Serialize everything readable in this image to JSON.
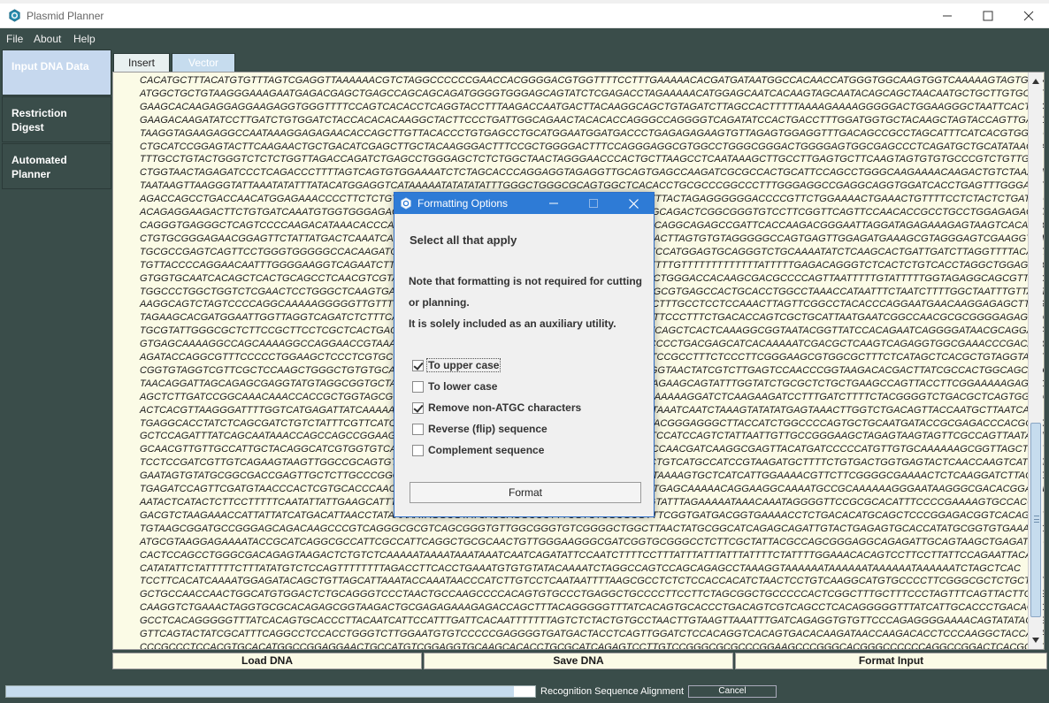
{
  "window": {
    "title": "Plasmid Planner",
    "minimize_icon": "minimize-icon",
    "maximize_icon": "maximize-icon",
    "close_icon": "close-icon"
  },
  "menu": [
    "File",
    "About",
    "Help"
  ],
  "sidebar": {
    "items": [
      {
        "label": "Input DNA Data",
        "active": true
      },
      {
        "label": "Restriction Digest",
        "active": false
      },
      {
        "label": "Automated Planner",
        "active": false
      }
    ]
  },
  "tabs": [
    {
      "label": "Insert",
      "active": false
    },
    {
      "label": "Vector",
      "active": true
    }
  ],
  "sequence_lines": [
    "CACATGCTTTACATGTGTTTAGTCGAGGTTAAAAAACGTCTAGGCCCCCCGAACCACGGGGACGTGGTTTTCCTTTGAAAAACACGATGATAATGGCCACAACCATGGGTGGCAAGTGGTCAAAAAGTAGTGTGATTGG",
    "ATGGCTGCTGTAAGGGAAAGAATGAGACGAGCTGAGCCAGCAGCAGATGGGGTGGGAGCAGTATCTCGAGACCTAGAAAAACATGGAGCAATCACAAGTAGCAATACAGCAGCTAACAATGCTGCTTGTGCCTGGCTA",
    "GAAGCACAAGAGGAGGAAGAGGTGGGTTTTCCAGTCACACCTCAGGTACCTTTAAGACCAATGACTTACAAGGCAGCTGTAGATCTTAGCCACTTTTTAAAAGAAAAGGGGGACTGGAAGGGCTAATTCACTCCCAAA",
    "GAAGACAAGATATCCTTGATCTGTGGATCTACCACACACAAGGCTACTTCCCTGATTGGCAGAACTACACACCAGGGCCAGGGGTCAGATATCCACTGACCTTTGGATGGTGCTACAAGCTAGTACCAGTTGAGCCAGA",
    "TAAGGTAGAAGAGGCCAATAAAGGAGAGAACACCAGCTTGTTACACCCTGTGAGCCTGCATGGAATGGATGACCCTGAGAGAGAAGTGTTAGAGTGGAGGTTTGACAGCCGCCTAGCATTTCATCACGTGGCCCGAGAG",
    "CTGCATCCGGAGTACTTCAAGAACTGCTGACATCGAGCTTGCTACAAGGGACTTTCCGCTGGGGACTTTCCAGGGAGGCGTGGCCTGGGCGGGACTGGGGAGTGGCGAGCCCTCAGATGCTGCATATAAGCAGCTGCTT",
    "TTTGCCTGTACTGGGTCTCTCTGGTTAGACCAGATCTGAGCCTGGGAGCTCTCTGGCTAACTAGGGAACCCACTGCTTAAGCCTCAATAAAGCTTGCCTTGAGTGCTTCAAGTAGTGTGTGCCCGTCTGTTGTGTGACT",
    "CTGGTAACTAGAGATCCCTCAGACCCTTTTAGTCAGTGTGGAAAATCTCTAGCACCCAGGAGGTAGAGGTTGCAGTGAGCCAAGATCGCGCCACTGCATTCCAGCCTGGGCAAGAAAACAAGACTGTCTAAAATAATAA",
    "TAATAAGTTAAGGGTATTAAATATATTTATACATGGAGGTCATAAAAATATATATATTTGGGCTGGGCGCAGTGGCTCACACCTGCGCCCGGCCCTTTGGGAGGCCGAGGCAGGTGGATCACCTGAGTTTGGGAGTTCC",
    "AGACCAGCCTGACCAACATGGAGAAACCCCTTCTCTGTGTATTTTTAGTAGATTTTATTTTATTGTATTTTATTCAGCTTTTACTAGAGGGGGGACCCCGTTCTGGAAAACTGAAACTGTTTTCCTCTACTCTGATACCACAAGAATCATCAGC",
    "ACAGAGGAAGACTTCTGTGATCAAATGTGGTGGGAGAGGGAGGTTTTCACCAGCACATGAGCAGTCAGTTCTGCCGCAGACTCGGCGGGTGTCCTTCGGTTCAGTTCCAACACCGCCTGCCTGGAGAGAGGTCAGCACCA",
    "CAGGGTGAGGGCTCAGTCCCCAAGACATAAACACCCAAGACATAAACACCCAACAGGTCCACCCCGCCTGCTGCCCAGGCAGAGCCGATTCACCAAGACGGGAATTAGGATAGAGAAAGAGTAAGTCACACAGAGCCGG",
    "CTGTGCGGGAGAACGGAGTTCTATTATGACTCAAATCAGTCTCCCCAAGCATTCGGGGATCAGAGTTTTTAAGGATAACTTAGTGTGTAGGGGGCCAGTGAGTTGGAGATGAAAGCGTAGGGAGTCGAAGGTGTCCTTT",
    "TGCGCCGAGTCAGTTCCTGGGTGGGGGCCACAAGATCGGATGAGCCAGTTTATCAATCCGGGGGTGCCAGCTGATCCATGGAGTGCAGGGTCTGCAAAATATCTCAAGCACTGATTGATCTTAGGTTTTACAATAGTGA",
    "TGTTACCCCAGGAACAATTTGGGGAAGGTCAGAATCTTGTAGCCTGTAGCTGCATGACTCCTAAACCATAATTTCTTTTTTGTTTTTTTTTTTTTATTTTTGAGACAGGGTCTCACTCTGTCACCTAGGCTGGAGTGCA",
    "GTGGTGCAATCACAGCTCACTGCAGCCTCAACGTCGTAAGCTCAAGCGATCCTCCCACCTCAGCCTCCCGAGCAGCTGGGACCACAAGCGACGCCCCAGTTAATTTTTGTATTTTTGGTAGAGGCAGCGTTTTGCCGTG",
    "TGGCCCTGGCTGGTCTCGAACTCCTGGGCTCAAGTGATCCACCCACCTCAGCCTCCCAAAGTGCTGGGATTACAGGCGTGAGCCACTGCACCTGGCCTAAACCATAATTTCTAATCTTTTGGCTAATTTGTTAGTCCTACA",
    "AAGGCAGTCTAGTCCCCAGGCAAAAAGGGGGTTGTTTCGGTGTTGATTTTACTTATTTCACCACAAGGTTAGTTTACCTTTGCCTCCTCCAAACTTAGTTCGGCCTACACCCAGGAATGAACAAGGAGAGCTTGGAGGT",
    "TAGAAGCACGATGGAATTGGTTAGGTCAGATCTCTTTCACTGTCTGAGTTCCTCCAGGACTGCAAAGCTCTCATCATTTCCCTTTCTGACACCAGTCGCTGCATTAATGAATCGGCCAACGCGCGGGGAGAGGCGGTT",
    "TGCGTATTGGGCGCTCTTCCGCTTCCTCGCTCACTGACTCGCTGCGCTCGGTCGTTCGGCTGCGGCGAGCGGTATCAGCTCACTCAAAGGCGGTAATACGGTTATCCACAGAATCAGGGGATAACGCAGGAAAGAACAT",
    "GTGAGCAAAAGGCCAGCAAAAGGCCAGGAACCGTAAAAAGGCCGCGTTGCTGGCGTTTTTCCATAGGCTCCGCCCCCCTGACGAGCATCACAAAAATCGACGCTCAAGTCAGAGGTGGCGAAACCCGACAGGACTATAA",
    "AGATACCAGGCGTTTCCCCCTGGAAGCTCCCTCGTGCGCTCTCCTGTTCCGACCCTGCCGCTTACCGGATACCTGTCCGCCTTTCTCCCTTCGGGAAGCGTGGCGCTTTCTCATAGCTCACGCTGTAGGTATCTCAGTT",
    "CGGTGTAGGTCGTTCGCTCCAAGCTGGGCTGTGTGCACGAACCCCCCGTTCAGCCCGACCGCTGCGCCTTATCCGGTAACTATCGTCTTGAGTCCAACCCGGTAAGACACGACTTATCGCCACTGGCAGCAGCCACTGG",
    "TAACAGGATTAGCAGAGCGAGGTATGTAGGCGGTGCTACAGAGTTCTTGAAGTGGTGGCCTAACTACGGCTACACTAGAAGCAGTATTTGGTATCTGCGCTCTGCTGAAGCCAGTTACCTTCGGAAAAAGAGTTGGT",
    "AGCTCTTGATCCGGCAAACAAACCACCGCTGGTAGCGGTGGTTTTTTTGTTTGCAAGCAGCAGATTACGCGCAGAAAAAAAGGATCTCAAGAAGATCCTTTGATCTTTTCTACGGGGTCTGACGCTCAGTGGAACGAAA",
    "ACTCACGTTAAGGGATTTTGGTCATGAGATTATCAAAAAGGATCTTCACCTAGATCCTTTTAAATTAAAAATGAAGTTTTAAATCAATCTAAAGTATATATGAGTAAACTTGGTCTGACAGTTACCAATGCTTAATCAG",
    "TGAGGCACCTATCTCAGCGATCTGTCTATTTCGTTCATCCATAGTTGCCTGACTCCCCGTCGTGTAGATAACTACGATACGGGAGGGCTTACCATCTGGCCCCAGTGCTGCAATGATACCGCGAGACCCACGCTCACCG",
    "GCTCCAGATTTATCAGCAATAAACCAGCCAGCCGGAAGGGCCGAGCGCAGAAGTGGTCCTGCAACTTTATCCGCCTCCATCCAGTCTATTAATTGTTGCCGGGAAGCTAGAGTAAGTAGTTCGCCAGTTAATAGTTTGC",
    "GCAACGTTGTTGCCATTGCTACAGGCATCGTGGTGTCACGCTCGTCGTTTGGTATGGCTTCATTCAGCTCCGGTTCCCAACGATCAAGGCGAGTTACATGATCCCCCATGTTGTGCAAAAAAGCGGTTAGCTCCTTCGG",
    "TCCTCCGATCGTTGTCAGAAGTAAGTTGGCCGCAGTGTTATCACTCATGGTTATGGCAGCACTGCATAATTCTCTTACTGTCATGCCATCCGTAAGATGCTTTTCTGTGACTGGTGAGTACTCAACCAAGTCATTCTGA",
    "GAATAGTGTATGCGGCGACCGAGTTGCTCTTGCCCGGCGTCAATACGGGATAATACCGCGCCACATAGCAGAACTTTAAAAGTGCTCATCATTGGAAAACGTTCTTCGGGGCGAAAACTCTCAAGGATCTTACCGCTGT",
    "TGAGATCCAGTTCGATGTAACCCACTCGTGCACCCAACTGATCTTCAGCATCTTTTACTTTCACCAGCGTTTCTGGGTGAGCAAAAACAGGAAGGCAAAATGCCGCAAAAAAGGGAATAAGGGCGACACGGAAATGTTG",
    "AATACTCATACTCTTCCTTTTTCAATATTATTGAAGCATTTATCAGGGTTATTGTCTCATGAGCGGATACATATTTGAATGTATTTAGAAAAATAAACAAATAGGGGTTCCGCGCACATTTCCCCGAAAAGTGCCACCT",
    "GACGTCTAAGAAACCATTATTATCATGACATTAACCTATAAAAATAGGCGTATCACGAGGCCCTTTCGTCTCGCGCGTTTCGGTGATGACGGTGAAAACCTCTGACACATGCAGCTCCCGGAGACGGTCACAGCTTGTC",
    "TGTAAGCGGATGCCGGGAGCAGACAAGCCCGTCAGGGCGCGTCAGCGGGTGTTGGCGGGTGTCGGGGCTGGCTTAACTATGCGGCATCAGAGCAGATTGTACTGAGAGTGCACCATATGCGGTGTGAAATACCGCACAG",
    "ATGCGTAAGGAGAAAATACCGCATCAGGCGCCATTCGCCATTCAGGCTGCGCAACTGTTGGGAAGGGCGATCGGTGCGGGCCTCTTCGCTATTACGCCAGCGGGAGGCAGAGATTGCAGTAAGCTGAGATCGCAGCACTG",
    "CACTCCAGCCTGGGCGACAGAGTAAGACTCTGTCTCAAAAATAAAATAAATAAATCAATCAGATATTCCAATCTTTTCCTTTATTTATTTATTTATTTTCTATTTTGGAAACACAGTCCTTCCTTATTCCAGAATTACA",
    "CATATATTCTATTTTTCTTTATATGTCTCCAGTTTTTTTTAGACCTTCACCTGAAATGTGTGTATACAAAATCTAGGCCAGTCCAGCAGAGCCTAAAGGTAAAAAATAAAAAATAAAAAATAAAAAATCTAGCTCAC",
    "TCCTTCACATCAAAATGGAGATACAGCTGTTAGCATTAAATACCAAATAACCCATCTTGTCCTCAATAATTTTAAGCGCCTCTCTCCACCACATCTAACTCCTGTCAAGGCATGTGCCCCTTCGGGCGCTCTGCTGT",
    "GCTGCCAACCAACTGGCATGTGGACTCTGCAGGGTCCCTAACTGCCAAGCCCCACAGTGTGCCCTGAGGCTGCCCCTTCCTTCTAGCGGCTGCCCCCACTCGGCTTTGCTTTCCCTAGTTTCAGTTACTTGCGTTCAGC",
    "CAAGGTCTGAAACTAGGTGCGCACAGAGCGGTAAGACTGCGAGAGAAAGAGACCAGCTTTACAGGGGGTTTATCACAGTGCACCCTGACAGTCGTCAGCCTCACAGGGGGTTTATCATTGCACCCTGACAGTCGTCA",
    "GCCTCACAGGGGGTTTATCACAGTGCACCCTTACAATCATTCCATTTGATTCACAATTTTTTTAGTCTCTACTGTGCCTAACTTGTAAGTTAAATTTGATCAGAGGTGTGTTCCCAGAGGGGAAAACAGTATATACAGG",
    "GTTCAGTACTATCGCATTTCAGGCCTCCACCTGGGTCTTGGAATGTGTCCCCCGAGGGGTGATGACTACCTCAGTTGGATCTCCACAGGTCACAGTGACACAAGATAACCAAGACACCTCCCAAGGCTACCACAATGGG",
    "CCCGCCCTCCACGTGCACATGGCCGGAGGAACTGCCATGTCGGAGGTGCAAGCACACCTGCGCATCAGAGTCCTTGTCCGGGCGCGCCCGGAAGCCCGGGCACGGGCCCCCCAGGCCGGACTCACGGCCACGACGGCAAC"
  ],
  "bottom_buttons": [
    "Load DNA",
    "Save DNA",
    "Format Input"
  ],
  "status": {
    "progress_fraction": 0.96,
    "label": "Recognition Sequence Alignment",
    "cancel_label": "Cancel"
  },
  "dialog": {
    "title": "Formatting Options",
    "heading": "Select all that apply",
    "note_line1": "Note that formatting is not required for cutting",
    "note_line2": "or planning.",
    "note_line3": "It is solely included as an auxiliary utility.",
    "options": [
      {
        "label": "To upper case",
        "checked": true,
        "focused": true
      },
      {
        "label": "To lower case",
        "checked": false,
        "focused": false
      },
      {
        "label": "Remove non-ATGC characters",
        "checked": true,
        "focused": false
      },
      {
        "label": "Reverse (flip) sequence",
        "checked": false,
        "focused": false
      },
      {
        "label": "Complement sequence",
        "checked": false,
        "focused": false
      }
    ],
    "format_button": "Format"
  },
  "colors": {
    "app_bg": "#3a4d4a",
    "active_tab": "#c6dcee",
    "sequence_bg": "#fbfbe6",
    "dialog_title_bg": "#2e7bd6"
  }
}
